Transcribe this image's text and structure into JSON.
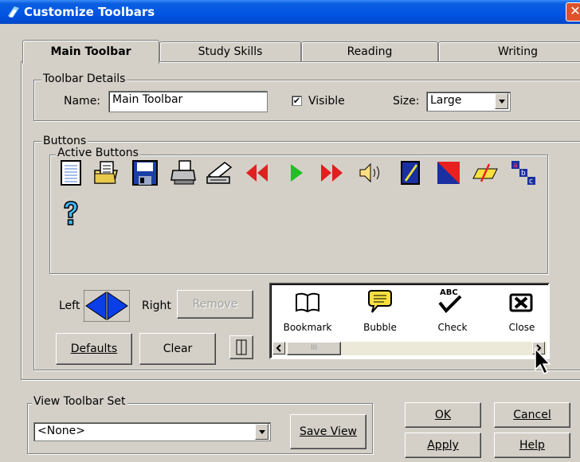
{
  "window": {
    "title": "Customize Toolbars",
    "close_label": "✕"
  },
  "tabs": [
    {
      "label": "Main Toolbar"
    },
    {
      "label": "Study Skills"
    },
    {
      "label": "Reading"
    },
    {
      "label": "Writing"
    }
  ],
  "details": {
    "group_label": "Toolbar Details",
    "name_label": "Name:",
    "name_value": "Main Toolbar",
    "visible_label": "Visible",
    "visible_checked": true,
    "size_label": "Size:",
    "size_value": "Large"
  },
  "buttons": {
    "group_label": "Buttons",
    "active_label": "Active Buttons",
    "active_icons": [
      "page-icon",
      "open-file-icon",
      "save-icon",
      "print-icon",
      "scan-icon",
      "rewind-icon",
      "play-icon",
      "fast-forward-icon",
      "speaker-icon",
      "highlighter-blue-icon",
      "highlighter-red-icon",
      "highlighter-yellow-icon",
      "abc-letters-icon",
      "help-icon"
    ],
    "left_label": "Left",
    "right_label": "Right",
    "remove_label": "Remove",
    "defaults_label": "Defaults",
    "clear_label": "Clear"
  },
  "palette": {
    "items": [
      {
        "label": "Bookmark",
        "icon": "book-icon"
      },
      {
        "label": "Bubble",
        "icon": "speech-bubble-icon"
      },
      {
        "label": "Check",
        "icon": "abc-check-icon"
      },
      {
        "label": "Close",
        "icon": "close-x-icon"
      }
    ],
    "scroll_thumb": "III"
  },
  "view": {
    "group_label": "View Toolbar Set",
    "select_value": "<None>",
    "save_label": "Save View"
  },
  "dialog": {
    "ok_label": "OK",
    "cancel_label": "Cancel",
    "apply_label": "Apply",
    "help_label": "Help"
  },
  "colors": {
    "title_bg": "#0054e3",
    "dialog_bg": "#d4d0c8"
  }
}
